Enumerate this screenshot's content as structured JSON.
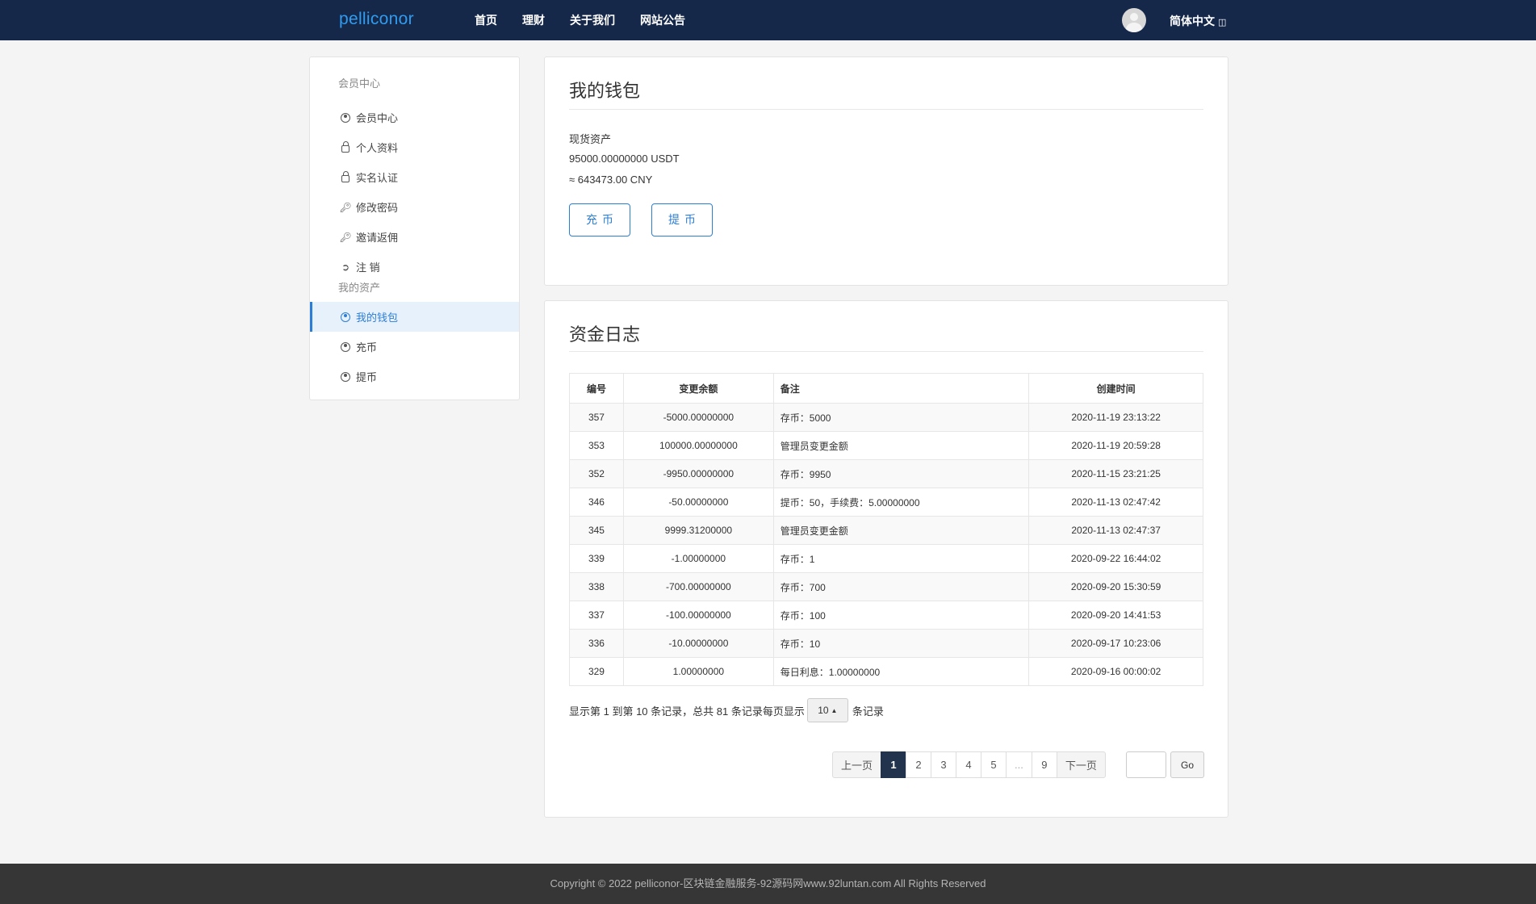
{
  "header": {
    "brand": "pelliconor",
    "nav": [
      "首页",
      "理财",
      "关于我们",
      "网站公告"
    ],
    "language": "简体中文"
  },
  "sidebar": {
    "group1": "会员中心",
    "items1": [
      {
        "label": "会员中心",
        "icon": "user-circle-icon"
      },
      {
        "label": "个人资料",
        "icon": "lock-icon"
      },
      {
        "label": "实名认证",
        "icon": "lock-icon"
      },
      {
        "label": "修改密码",
        "icon": "key-icon"
      },
      {
        "label": "邀请返佣",
        "icon": "key-icon"
      },
      {
        "label": "注 销",
        "icon": "sign-out-icon"
      }
    ],
    "group2": "我的资产",
    "items2": [
      {
        "label": "我的钱包",
        "icon": "user-circle-icon",
        "active": true
      },
      {
        "label": "充币",
        "icon": "user-circle-icon"
      },
      {
        "label": "提币",
        "icon": "user-circle-icon"
      }
    ]
  },
  "wallet": {
    "title": "我的钱包",
    "asset_label": "现货资产",
    "usdt": "95000.00000000 USDT",
    "cny": "≈ 643473.00 CNY",
    "deposit_btn": "充币",
    "withdraw_btn": "提币"
  },
  "log": {
    "title": "资金日志",
    "columns": [
      "编号",
      "变更余额",
      "备注",
      "创建时间"
    ],
    "rows": [
      [
        "357",
        "-5000.00000000",
        "存币：5000",
        "2020-11-19 23:13:22"
      ],
      [
        "353",
        "100000.00000000",
        "管理员变更金额",
        "2020-11-19 20:59:28"
      ],
      [
        "352",
        "-9950.00000000",
        "存币：9950",
        "2020-11-15 23:21:25"
      ],
      [
        "346",
        "-50.00000000",
        "提币：50，手续费：5.00000000",
        "2020-11-13 02:47:42"
      ],
      [
        "345",
        "9999.31200000",
        "管理员变更金额",
        "2020-11-13 02:47:37"
      ],
      [
        "339",
        "-1.00000000",
        "存币：1",
        "2020-09-22 16:44:02"
      ],
      [
        "338",
        "-700.00000000",
        "存币：700",
        "2020-09-20 15:30:59"
      ],
      [
        "337",
        "-100.00000000",
        "存币：100",
        "2020-09-20 14:41:53"
      ],
      [
        "336",
        "-10.00000000",
        "存币：10",
        "2020-09-17 10:23:06"
      ],
      [
        "329",
        "1.00000000",
        "每日利息：1.00000000",
        "2020-09-16 00:00:02"
      ]
    ],
    "info_prefix": "显示第 1 到第 10 条记录，总共 81 条记录每页显示",
    "page_size": "10",
    "info_suffix": "条记录",
    "pager": {
      "prev": "上一页",
      "pages": [
        "1",
        "2",
        "3",
        "4",
        "5",
        "...",
        "9"
      ],
      "active": "1",
      "next": "下一页",
      "go": "Go"
    }
  },
  "footer": "Copyright © 2022 pelliconor-区块链金融服务-92源码网www.92luntan.com All Rights Reserved"
}
